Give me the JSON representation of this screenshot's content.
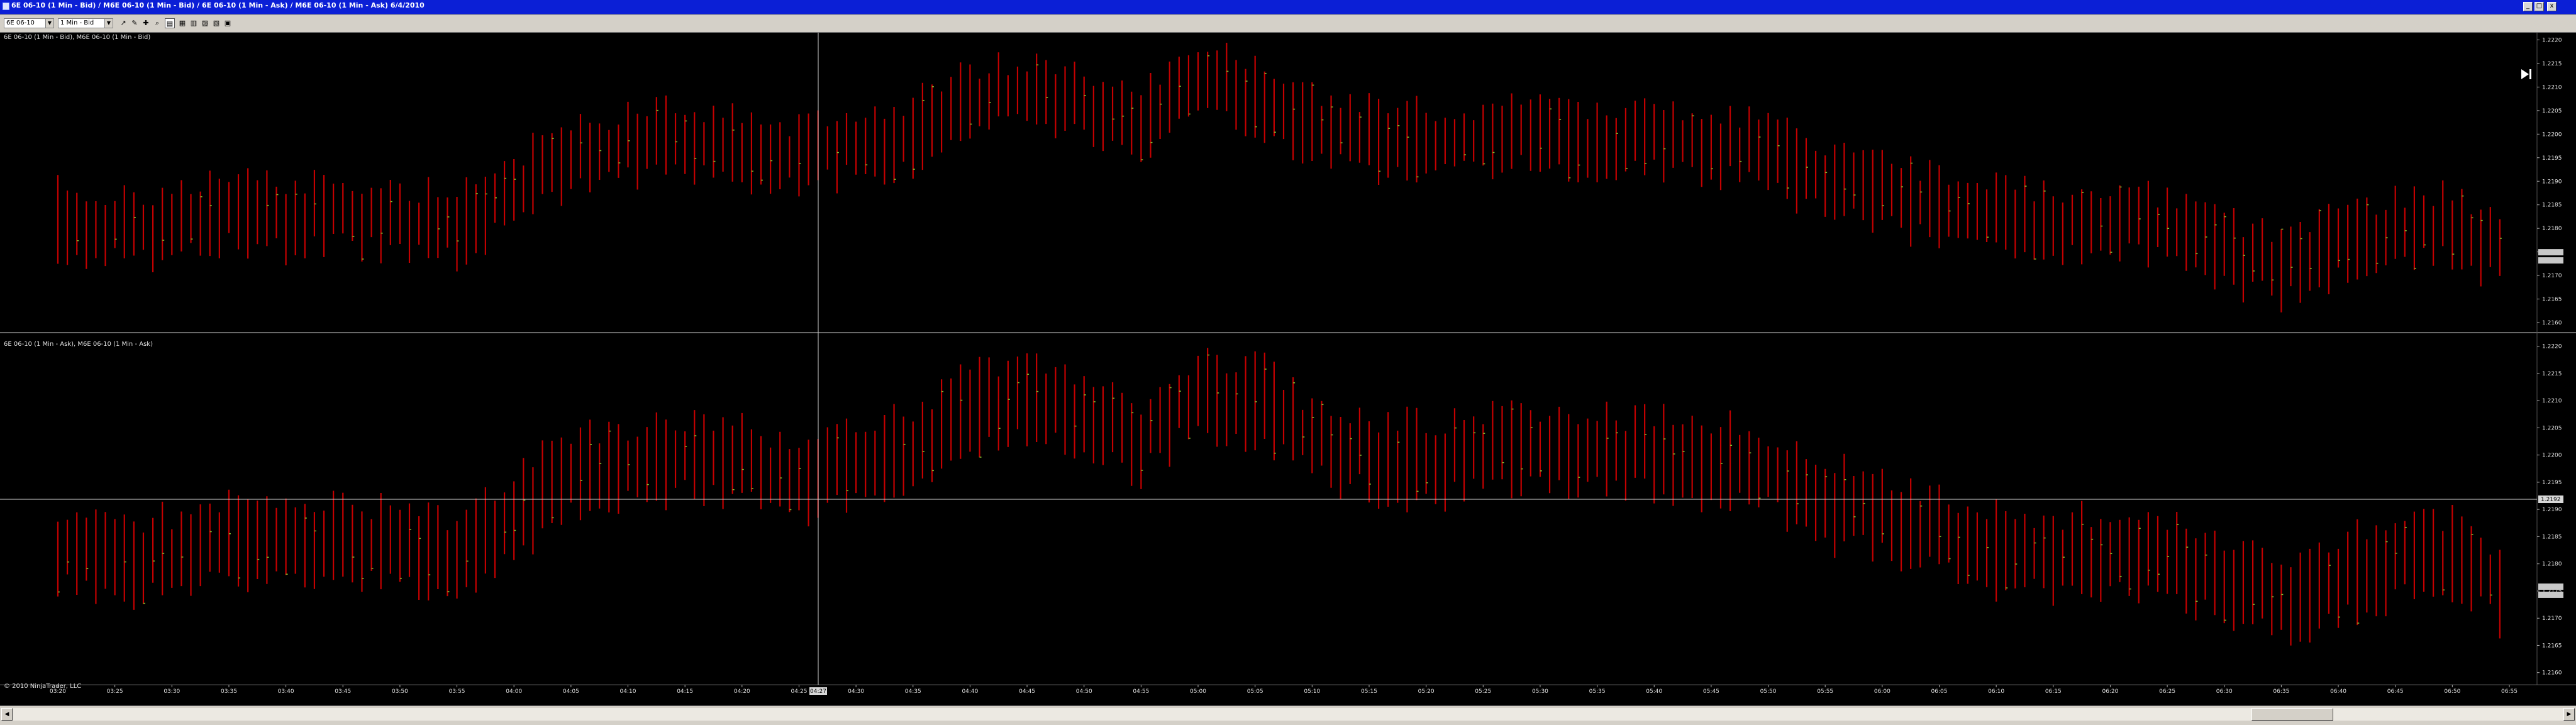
{
  "window": {
    "title": "6E 06-10 (1 Min - Bid) / M6E 06-10 (1 Min - Bid) / 6E 06-10 (1 Min - Ask) / M6E 06-10 (1 Min - Ask)   6/4/2010",
    "buttons": {
      "minimize": "_",
      "maximize": "□",
      "close": "x"
    }
  },
  "toolbar": {
    "instrument": "6E 06-10",
    "interval": "1 Min - Bid",
    "icons": [
      "draw-tool-icon",
      "pencil-icon",
      "crosshair-icon",
      "zoom-icon",
      "data-box-icon",
      "properties-icon",
      "strategy-icon",
      "indicator-icon",
      "bar-type-icon",
      "template-icon"
    ]
  },
  "panels": [
    {
      "label": "6E 06-10 (1 Min - Bid), M6E 06-10 (1 Min - Bid)"
    },
    {
      "label": "6E 06-10 (1 Min - Ask), M6E 06-10 (1 Min - Ask)"
    }
  ],
  "copyright": "© 2010 NinjaTrader, LLC",
  "price_axis": {
    "ticks": [
      "1.2220",
      "1.2215",
      "1.2210",
      "1.2205",
      "1.2200",
      "1.2195",
      "1.2190",
      "1.2185",
      "1.2180",
      "1.2175",
      "1.2170",
      "1.2165",
      "1.2160"
    ],
    "crosshair_price": "1.2192"
  },
  "time_axis": {
    "ticks": [
      "03:20",
      "03:25",
      "03:30",
      "03:35",
      "03:40",
      "03:45",
      "03:50",
      "03:55",
      "04:00",
      "04:05",
      "04:10",
      "04:15",
      "04:20",
      "04:25",
      "04:30",
      "04:35",
      "04:40",
      "04:45",
      "04:50",
      "04:55",
      "05:00",
      "05:05",
      "05:10",
      "05:15",
      "05:20",
      "05:25",
      "05:30",
      "05:35",
      "05:40",
      "05:45",
      "05:50",
      "05:55",
      "06:00",
      "06:05",
      "06:10",
      "06:15",
      "06:20",
      "06:25",
      "06:30",
      "06:35",
      "06:40",
      "06:45",
      "06:50",
      "06:55"
    ],
    "crosshair_time": "04:27"
  },
  "colors": {
    "background": "#000000",
    "bar_red": "#c40000",
    "bar_green": "#7fbf2f",
    "title_bar": "#0b1fd6",
    "crosshair": "#d0d0d0"
  },
  "chart_data": {
    "type": "bar",
    "title": "",
    "xlabel": "",
    "ylabel": "",
    "x": [
      "03:20",
      "03:25",
      "03:30",
      "03:35",
      "03:40",
      "03:45",
      "03:50",
      "03:55",
      "04:00",
      "04:05",
      "04:10",
      "04:15",
      "04:20",
      "04:25",
      "04:30",
      "04:35",
      "04:40",
      "04:45",
      "04:50",
      "04:55",
      "05:00",
      "05:05",
      "05:10",
      "05:15",
      "05:20",
      "05:25",
      "05:30",
      "05:35",
      "05:40",
      "05:45",
      "05:50",
      "05:55",
      "06:00",
      "06:05",
      "06:10",
      "06:15",
      "06:20",
      "06:25",
      "06:30",
      "06:35",
      "06:40",
      "06:45",
      "06:50",
      "06:55"
    ],
    "ylim": [
      1.2158,
      1.2221
    ],
    "series": [
      {
        "name": "6E 06-10 (1 Min - Bid)",
        "values": [
          1.2182,
          1.218,
          1.2181,
          1.2184,
          1.2182,
          1.2183,
          1.2182,
          1.218,
          1.2188,
          1.2196,
          1.2197,
          1.2199,
          1.2197,
          1.2195,
          1.2198,
          1.22,
          1.2207,
          1.2209,
          1.2206,
          1.2202,
          1.2211,
          1.2209,
          1.2202,
          1.2199,
          1.2198,
          1.2199,
          1.22,
          1.2199,
          1.2199,
          1.2198,
          1.2196,
          1.219,
          1.2188,
          1.2184,
          1.2182,
          1.2181,
          1.2182,
          1.218,
          1.2175,
          1.2172,
          1.2176,
          1.218,
          1.2181,
          1.2174
        ]
      },
      {
        "name": "6E 06-10 (1 Min - Ask)",
        "values": [
          1.2183,
          1.2181,
          1.2182,
          1.2185,
          1.2183,
          1.2184,
          1.2183,
          1.2181,
          1.2189,
          1.2197,
          1.2198,
          1.22,
          1.2198,
          1.2196,
          1.2199,
          1.2201,
          1.2208,
          1.221,
          1.2207,
          1.2203,
          1.2212,
          1.221,
          1.2203,
          1.22,
          1.2199,
          1.22,
          1.2201,
          1.22,
          1.22,
          1.2199,
          1.2197,
          1.2191,
          1.2189,
          1.2185,
          1.2183,
          1.2182,
          1.2183,
          1.2181,
          1.2176,
          1.2173,
          1.2177,
          1.2181,
          1.2182,
          1.2175
        ]
      }
    ]
  }
}
